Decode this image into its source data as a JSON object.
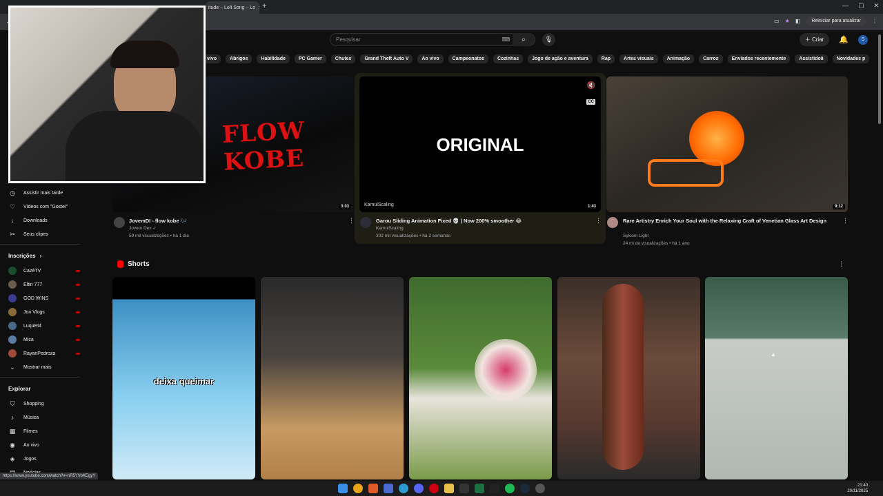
{
  "browser": {
    "tab_title": "itude – Lofi Song – Lo",
    "new_tab": "+",
    "restart_label": "Reiniciar para atualizar",
    "status_url": "https://www.youtube.com/watch?v=nR5YVoKEgyY"
  },
  "header": {
    "search_placeholder": "Pesquisar",
    "create_label": "Criar",
    "avatar_initial": "S"
  },
  "chips": [
    "vivo",
    "Abrigos",
    "Habilidade",
    "PC Gamer",
    "Chutes",
    "Grand Theft Auto V",
    "Ao vivo",
    "Campeonatos",
    "Cozinhas",
    "Jogo de ação e aventura",
    "Rap",
    "Artes visuais",
    "Animação",
    "Carros",
    "Enviados recentemente",
    "Assistidos",
    "Novidades p"
  ],
  "sidebar": {
    "you_items": [
      {
        "icon": "clock-icon",
        "glyph": "◷",
        "label": "Assistir mais tarde"
      },
      {
        "icon": "like-icon",
        "glyph": "♡",
        "label": "Vídeos com \"Gostei\""
      },
      {
        "icon": "download-icon",
        "glyph": "↓",
        "label": "Downloads"
      },
      {
        "icon": "scissors-icon",
        "glyph": "✂",
        "label": "Seus clipes"
      }
    ],
    "subs_title": "Inscrições",
    "subs": [
      {
        "name": "CazéTV",
        "color": "#1a4d2e"
      },
      {
        "name": "Eltin 777",
        "color": "#6b5b4b"
      },
      {
        "name": "GOD WINS",
        "color": "#3b3b8f"
      },
      {
        "name": "Jon Vlogs",
        "color": "#8a6a3a"
      },
      {
        "name": "LuquEt4",
        "color": "#4a6a8a"
      },
      {
        "name": "Mica",
        "color": "#5a7aa0"
      },
      {
        "name": "RayanPedroza",
        "color": "#a04a3a"
      }
    ],
    "show_more": "Mostrar mais",
    "explore_title": "Explorar",
    "explore_items": [
      {
        "icon": "shopping-icon",
        "glyph": "⛉",
        "label": "Shopping"
      },
      {
        "icon": "music-icon",
        "glyph": "♪",
        "label": "Música"
      },
      {
        "icon": "film-icon",
        "glyph": "▦",
        "label": "Filmes"
      },
      {
        "icon": "live-icon",
        "glyph": "◉",
        "label": "Ao vivo"
      },
      {
        "icon": "gamepad-icon",
        "glyph": "◈",
        "label": "Jogos"
      },
      {
        "icon": "news-icon",
        "glyph": "▤",
        "label": "Notícias"
      }
    ]
  },
  "videos": [
    {
      "title": "JovemDI - flow kobe 🎶",
      "channel": "Jovem Dex ✓",
      "stats": "59 mil visualizações • há 1 dia",
      "duration": "3:03",
      "thumb_text": "FLOW KOBE"
    },
    {
      "title": "Garou Sliding Animation Fixed 💀 | Now 200% smoother 😂",
      "channel": "KamulScaling",
      "stats": "302 mil visualizações • há 2 semanas",
      "duration": "1:43",
      "overlay_channel": "KamulScaling",
      "thumb_text": "ORIGINAL"
    },
    {
      "title": "Rare Artistry Enrich Your Soul with the Relaxing Craft of Venetian Glass Art Design",
      "title2": "Sylcom Light",
      "channel": "Sylcom Light",
      "stats": "24 mi de visualizações • há 1 ano",
      "duration": "9:12"
    }
  ],
  "shorts": {
    "title": "Shorts",
    "items": [
      {
        "caption": "deixa queimar"
      },
      {
        "caption": ""
      },
      {
        "caption": ""
      },
      {
        "caption": ""
      },
      {
        "caption": ""
      }
    ]
  },
  "taskbar": {
    "time": "21:40",
    "date": "20/11/2025"
  }
}
